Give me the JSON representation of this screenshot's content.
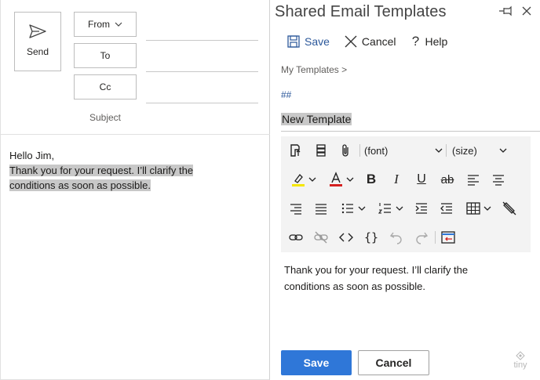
{
  "compose": {
    "send_label": "Send",
    "from_label": "From",
    "to_label": "To",
    "cc_label": "Cc",
    "subject_label": "Subject",
    "body_greeting": "Hello Jim,",
    "body_line1": "Thank you for your request. I’ll clarify the",
    "body_line2": "conditions as soon as possible."
  },
  "pane": {
    "title": "Shared Email Templates",
    "commands": {
      "save": "Save",
      "cancel": "Cancel",
      "help": "Help"
    },
    "breadcrumb": "My Templates >",
    "hashes": "##",
    "template_name": "New Template",
    "toolbar": {
      "font_family": "(font)",
      "font_size": "(size)"
    },
    "editor_line1": "Thank you for your request. I’ll clarify the",
    "editor_line2": "conditions as soon as possible.",
    "footer": {
      "save": "Save",
      "cancel": "Cancel"
    },
    "brand": "tiny"
  },
  "colors": {
    "accent": "#2f77d8",
    "command_blue": "#2b579a",
    "highlight": "#c8c8c8",
    "highlighter_yellow": "#f5e700",
    "font_color_red": "#d42020"
  },
  "icons": [
    "send-icon",
    "chevron-down-icon",
    "pin-icon",
    "close-icon",
    "save-icon",
    "cancel-x-icon",
    "help-icon",
    "insert-template-icon",
    "field-icon",
    "attach-icon",
    "highlight-icon",
    "font-color-icon",
    "bold-icon",
    "italic-icon",
    "underline-icon",
    "strikethrough-icon",
    "align-left-icon",
    "align-center-icon",
    "align-right-icon",
    "justify-icon",
    "bullet-list-icon",
    "numbered-list-icon",
    "indent-icon",
    "outdent-icon",
    "table-icon",
    "clear-format-icon",
    "link-icon",
    "unlink-icon",
    "code-icon",
    "source-code-icon",
    "undo-icon",
    "redo-icon",
    "insert-field-icon",
    "tiny-logo-icon"
  ]
}
